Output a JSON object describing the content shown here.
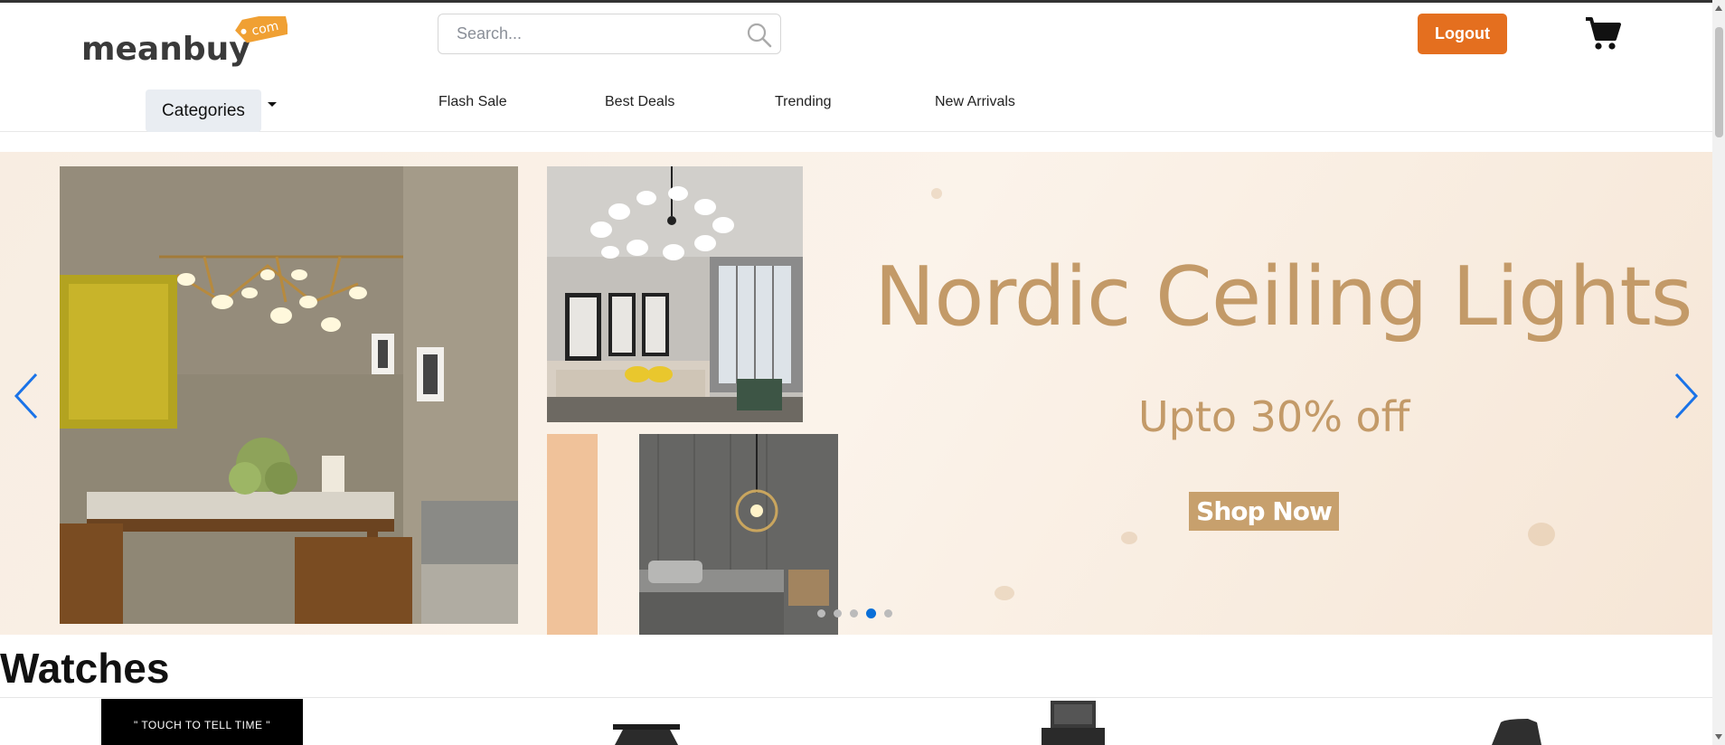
{
  "header": {
    "logo_text": "meanbuy",
    "logo_tag": "com",
    "search_placeholder": "Search...",
    "logout_label": "Logout",
    "brand_color": "#e46f1f"
  },
  "nav": {
    "categories_label": "Categories",
    "links": [
      "Flash Sale",
      "Best Deals",
      "Trending",
      "New Arrivals"
    ]
  },
  "banner": {
    "title": "Nordic Ceiling Lights",
    "subtitle": "Upto 30% off",
    "cta_label": "Shop Now",
    "slides_total": 5,
    "active_slide": 4,
    "accent_color": "#c39a68",
    "dot_active_color": "#0a6fd8"
  },
  "section": {
    "title": "Watches",
    "products": [
      {
        "overlay_text": "\" TOUCH TO TELL TIME \""
      },
      {
        "overlay_text": ""
      },
      {
        "overlay_text": ""
      },
      {
        "overlay_text": ""
      }
    ]
  }
}
